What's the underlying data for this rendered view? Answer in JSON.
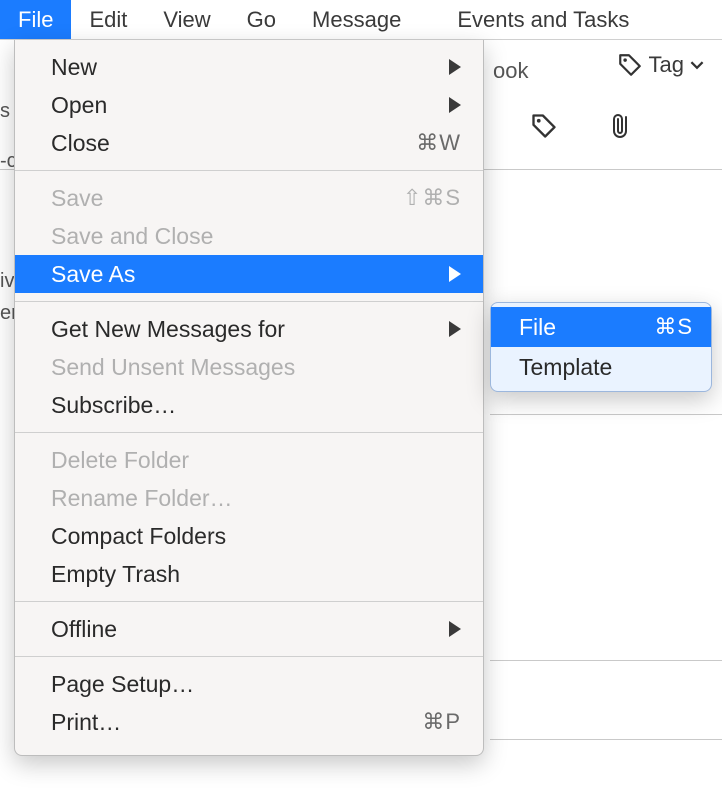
{
  "menubar": {
    "items": [
      {
        "label": "File",
        "active": true
      },
      {
        "label": "Edit",
        "active": false
      },
      {
        "label": "View",
        "active": false
      },
      {
        "label": "Go",
        "active": false
      },
      {
        "label": "Message",
        "active": false
      },
      {
        "label": "Events and Tasks",
        "active": false
      }
    ]
  },
  "toolbar": {
    "book_fragment": "ook",
    "tag_label": "Tag",
    "left_fragments": {
      "s": "s",
      "dash_c": "-c",
      "iv": "iv",
      "er": "er"
    }
  },
  "file_menu": {
    "groups": [
      [
        {
          "key": "new",
          "label": "New",
          "shortcut": "",
          "submenu": true,
          "disabled": false
        },
        {
          "key": "open",
          "label": "Open",
          "shortcut": "",
          "submenu": true,
          "disabled": false
        },
        {
          "key": "close",
          "label": "Close",
          "shortcut": "⌘W",
          "submenu": false,
          "disabled": false
        }
      ],
      [
        {
          "key": "save",
          "label": "Save",
          "shortcut": "⇧⌘S",
          "submenu": false,
          "disabled": true
        },
        {
          "key": "saveandclose",
          "label": "Save and Close",
          "shortcut": "",
          "submenu": false,
          "disabled": true
        },
        {
          "key": "saveas",
          "label": "Save As",
          "shortcut": "",
          "submenu": true,
          "disabled": false,
          "highlight": true
        }
      ],
      [
        {
          "key": "getnew",
          "label": "Get New Messages for",
          "shortcut": "",
          "submenu": true,
          "disabled": false
        },
        {
          "key": "sendunsent",
          "label": "Send Unsent Messages",
          "shortcut": "",
          "submenu": false,
          "disabled": true
        },
        {
          "key": "subscribe",
          "label": "Subscribe…",
          "shortcut": "",
          "submenu": false,
          "disabled": false
        }
      ],
      [
        {
          "key": "deletefolder",
          "label": "Delete Folder",
          "shortcut": "",
          "submenu": false,
          "disabled": true
        },
        {
          "key": "renamefolder",
          "label": "Rename Folder…",
          "shortcut": "",
          "submenu": false,
          "disabled": true
        },
        {
          "key": "compact",
          "label": "Compact Folders",
          "shortcut": "",
          "submenu": false,
          "disabled": false
        },
        {
          "key": "emptytrash",
          "label": "Empty Trash",
          "shortcut": "",
          "submenu": false,
          "disabled": false
        }
      ],
      [
        {
          "key": "offline",
          "label": "Offline",
          "shortcut": "",
          "submenu": true,
          "disabled": false
        }
      ],
      [
        {
          "key": "pagesetup",
          "label": "Page Setup…",
          "shortcut": "",
          "submenu": false,
          "disabled": false
        },
        {
          "key": "print",
          "label": "Print…",
          "shortcut": "⌘P",
          "submenu": false,
          "disabled": false
        }
      ]
    ]
  },
  "saveas_submenu": {
    "items": [
      {
        "key": "file",
        "label": "File",
        "shortcut": "⌘S",
        "highlight": true
      },
      {
        "key": "template",
        "label": "Template",
        "shortcut": "",
        "highlight": false
      }
    ]
  }
}
